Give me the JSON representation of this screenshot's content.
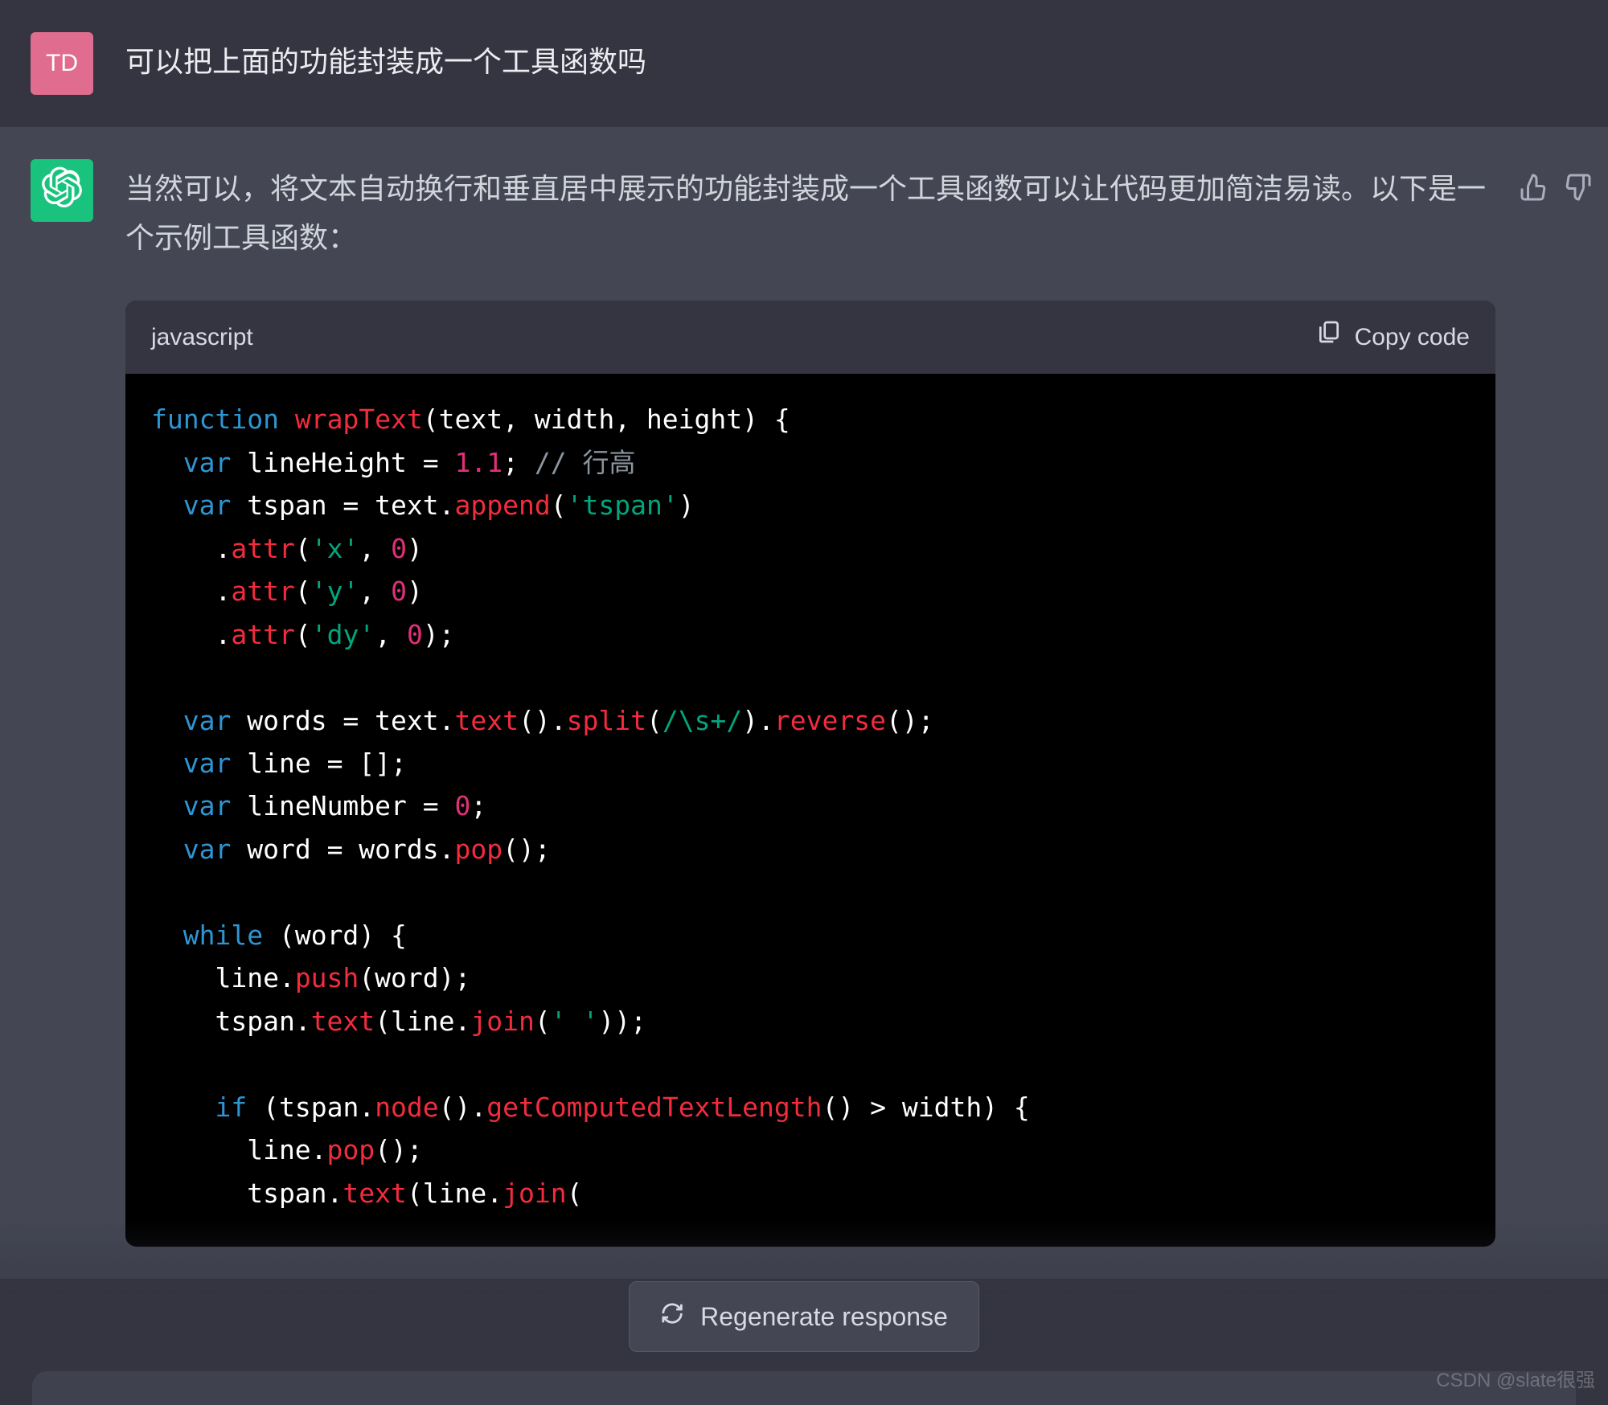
{
  "user": {
    "avatar_initials": "TD",
    "message": "可以把上面的功能封装成一个工具函数吗"
  },
  "assistant": {
    "preamble": "当然可以，将文本自动换行和垂直居中展示的功能封装成一个工具函数可以让代码更加简洁易读。以下是一个示例工具函数：",
    "code": {
      "language": "javascript",
      "copy_label": "Copy code",
      "tokens": [
        [
          [
            "kw",
            "function"
          ],
          [
            "txt",
            " "
          ],
          [
            "fn",
            "wrapText"
          ],
          [
            "txt",
            "(text, width, height) {"
          ]
        ],
        [
          [
            "txt",
            "  "
          ],
          [
            "kw",
            "var"
          ],
          [
            "txt",
            " lineHeight = "
          ],
          [
            "num",
            "1.1"
          ],
          [
            "txt",
            "; "
          ],
          [
            "cm",
            "// 行高"
          ]
        ],
        [
          [
            "txt",
            "  "
          ],
          [
            "kw",
            "var"
          ],
          [
            "txt",
            " tspan = text."
          ],
          [
            "fn",
            "append"
          ],
          [
            "txt",
            "("
          ],
          [
            "str",
            "'tspan'"
          ],
          [
            "txt",
            ")"
          ]
        ],
        [
          [
            "txt",
            "    ."
          ],
          [
            "fn",
            "attr"
          ],
          [
            "txt",
            "("
          ],
          [
            "str",
            "'x'"
          ],
          [
            "txt",
            ", "
          ],
          [
            "num",
            "0"
          ],
          [
            "txt",
            ")"
          ]
        ],
        [
          [
            "txt",
            "    ."
          ],
          [
            "fn",
            "attr"
          ],
          [
            "txt",
            "("
          ],
          [
            "str",
            "'y'"
          ],
          [
            "txt",
            ", "
          ],
          [
            "num",
            "0"
          ],
          [
            "txt",
            ")"
          ]
        ],
        [
          [
            "txt",
            "    ."
          ],
          [
            "fn",
            "attr"
          ],
          [
            "txt",
            "("
          ],
          [
            "str",
            "'dy'"
          ],
          [
            "txt",
            ", "
          ],
          [
            "num",
            "0"
          ],
          [
            "txt",
            ");"
          ]
        ],
        [
          [
            "txt",
            ""
          ]
        ],
        [
          [
            "txt",
            "  "
          ],
          [
            "kw",
            "var"
          ],
          [
            "txt",
            " words = text."
          ],
          [
            "fn",
            "text"
          ],
          [
            "txt",
            "()."
          ],
          [
            "fn",
            "split"
          ],
          [
            "txt",
            "("
          ],
          [
            "re",
            "/\\s+/"
          ],
          [
            "txt",
            ")."
          ],
          [
            "fn",
            "reverse"
          ],
          [
            "txt",
            "();"
          ]
        ],
        [
          [
            "txt",
            "  "
          ],
          [
            "kw",
            "var"
          ],
          [
            "txt",
            " line = [];"
          ]
        ],
        [
          [
            "txt",
            "  "
          ],
          [
            "kw",
            "var"
          ],
          [
            "txt",
            " lineNumber = "
          ],
          [
            "num",
            "0"
          ],
          [
            "txt",
            ";"
          ]
        ],
        [
          [
            "txt",
            "  "
          ],
          [
            "kw",
            "var"
          ],
          [
            "txt",
            " word = words."
          ],
          [
            "fn",
            "pop"
          ],
          [
            "txt",
            "();"
          ]
        ],
        [
          [
            "txt",
            ""
          ]
        ],
        [
          [
            "txt",
            "  "
          ],
          [
            "kw",
            "while"
          ],
          [
            "txt",
            " (word) {"
          ]
        ],
        [
          [
            "txt",
            "    line."
          ],
          [
            "fn",
            "push"
          ],
          [
            "txt",
            "(word);"
          ]
        ],
        [
          [
            "txt",
            "    tspan."
          ],
          [
            "fn",
            "text"
          ],
          [
            "txt",
            "(line."
          ],
          [
            "fn",
            "join"
          ],
          [
            "txt",
            "("
          ],
          [
            "str",
            "' '"
          ],
          [
            "txt",
            "));"
          ]
        ],
        [
          [
            "txt",
            ""
          ]
        ],
        [
          [
            "txt",
            "    "
          ],
          [
            "kw",
            "if"
          ],
          [
            "txt",
            " (tspan."
          ],
          [
            "fn",
            "node"
          ],
          [
            "txt",
            "()."
          ],
          [
            "fn",
            "getComputedTextLength"
          ],
          [
            "txt",
            "() > width) {"
          ]
        ],
        [
          [
            "txt",
            "      line."
          ],
          [
            "fn",
            "pop"
          ],
          [
            "txt",
            "();"
          ]
        ],
        [
          [
            "txt",
            "      tspan."
          ],
          [
            "fn",
            "text"
          ],
          [
            "txt",
            "(line."
          ],
          [
            "fn",
            "join"
          ],
          [
            "txt",
            "("
          ]
        ]
      ]
    }
  },
  "controls": {
    "regenerate": "Regenerate response"
  },
  "watermark": "CSDN @slate很强"
}
